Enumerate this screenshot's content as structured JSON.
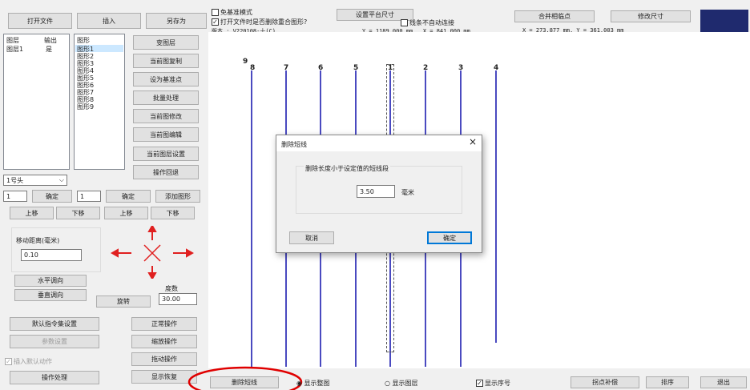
{
  "left_panel": {
    "open_file": "打开文件",
    "insert": "插入",
    "save_as": "另存为",
    "layer_list": {
      "col_layer": "图层",
      "col_output": "输出",
      "rows": [
        {
          "layer": "图层1",
          "output": "是"
        }
      ]
    },
    "shape_list": {
      "header": "图形",
      "items": [
        "图形1",
        "图形2",
        "图形3",
        "图形4",
        "图形5",
        "图形6",
        "图形7",
        "图形8",
        "图形9"
      ]
    },
    "side_buttons": [
      "变图层",
      "当前图复制",
      "设为基准点",
      "批量处理",
      "当前图修改",
      "当前图编辑",
      "当前图层设置",
      "操作回退"
    ],
    "head_select": "1号头",
    "input1": "1",
    "confirm1": "确定",
    "input2": "1",
    "confirm2": "确定",
    "add_shape": "添加图形",
    "move_buttons": [
      "上移",
      "下移",
      "上移",
      "下移"
    ],
    "move_distance_label": "移动距离(毫米)",
    "move_distance_value": "0.10",
    "horizontal_flip": "水平调向",
    "vertical_flip": "垂直调向",
    "rotate": "旋转",
    "degree_label": "度数",
    "degree_value": "30.00",
    "default_cmd_set": "默认指令集设置",
    "param_setting": "参数设置",
    "insert_default_action": "插入默认动作",
    "operation_process": "操作处理",
    "normal_op": "正常操作",
    "zoom_op": "缩放操作",
    "drag_op": "拖动操作",
    "display_restore": "显示恢复"
  },
  "top_bar": {
    "no_base_mode": "免基准模式",
    "delete_overlap": "打开文件时是否删除重合图形?",
    "version": "版本 :  V220108-十(C)",
    "set_platform_size": "设置平台尺寸",
    "platform_size": "Y = 1189.000 mm , X = 841.000 mm",
    "line_no_autoconnect": "线条不自动连接",
    "merge_points": "合并相临点",
    "modify_size": "修改尺寸",
    "coords": "X = 273.877 mm, Y = 361.003 mm"
  },
  "canvas": {
    "line_labels": [
      "9",
      "8",
      "7",
      "6",
      "5",
      "1",
      "2",
      "3",
      "4"
    ]
  },
  "dialog": {
    "title": "删除短线",
    "close": "×",
    "group_label": "删除长度小于设定值的短线段",
    "value": "3.50",
    "unit": "毫米",
    "cancel": "取消",
    "ok": "确定"
  },
  "bottom_bar": {
    "delete_short": "删除短线",
    "show_full": "显示整图",
    "show_layer": "显示图层",
    "show_order": "显示序号",
    "point_compensate": "拐点补偿",
    "sort": "排序",
    "exit": "退出"
  },
  "colors": {
    "accent": "#0078d7",
    "line": "#4a4ac0",
    "annotation": "#e00000",
    "top_block": "#1f2a6e"
  }
}
